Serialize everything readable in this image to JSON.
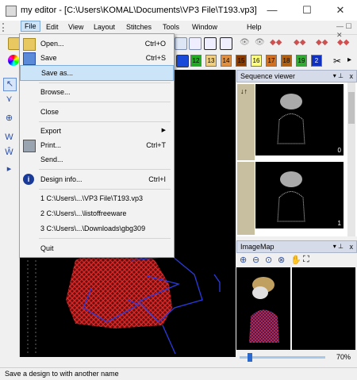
{
  "window": {
    "title": "my editor - [C:\\Users\\KOMAL\\Documents\\VP3 File\\T193.vp3]",
    "minimize": "—",
    "maximize": "☐",
    "close": "✕"
  },
  "menubar": {
    "items": [
      "File",
      "Edit",
      "View",
      "Layout",
      "Stitches",
      "Tools",
      "Window",
      "Help"
    ]
  },
  "file_menu": {
    "items": [
      {
        "label": "Open...",
        "shortcut": "Ctrl+O"
      },
      {
        "label": "Save",
        "shortcut": "Ctrl+S"
      },
      {
        "label": "Save as...",
        "shortcut": ""
      },
      {
        "label": "Browse...",
        "shortcut": ""
      },
      {
        "label": "Close",
        "shortcut": ""
      },
      {
        "label": "Export",
        "shortcut": "▶"
      },
      {
        "label": "Print...",
        "shortcut": "Ctrl+T"
      },
      {
        "label": "Send...",
        "shortcut": ""
      },
      {
        "label": "Design info...",
        "shortcut": "Ctrl+I"
      },
      {
        "label": "1 C:\\Users\\...\\VP3 File\\T193.vp3",
        "shortcut": ""
      },
      {
        "label": "2 C:\\Users\\...\\listoffreeware",
        "shortcut": ""
      },
      {
        "label": "3 C:\\Users\\...\\Downloads\\gbg309",
        "shortcut": ""
      },
      {
        "label": "Quit",
        "shortcut": ""
      }
    ]
  },
  "color_swatches": [
    {
      "label": "12",
      "color": "#22aa22"
    },
    {
      "label": "13",
      "color": "#f0d080"
    },
    {
      "label": "14",
      "color": "#e09040"
    },
    {
      "label": "15",
      "color": "#8a3c00"
    },
    {
      "label": "16",
      "color": "#ffff80"
    },
    {
      "label": "17",
      "color": "#d07020"
    },
    {
      "label": "18",
      "color": "#b06010"
    },
    {
      "label": "19",
      "color": "#33aa33"
    },
    {
      "label": "2",
      "color": "#1030c0"
    }
  ],
  "sequence_viewer": {
    "title": "Sequence viewer",
    "pin": "📌",
    "close": "x",
    "frames": [
      "0",
      "1"
    ]
  },
  "imagemap": {
    "title": "ImageMap",
    "zoom": "70%"
  },
  "statusbar": {
    "text": "Save a design to with another name"
  },
  "colors": {
    "accent": "#cce4f7",
    "canvas": "#000000",
    "stitch_red": "#d02020",
    "stitch_blue": "#2030e0"
  }
}
